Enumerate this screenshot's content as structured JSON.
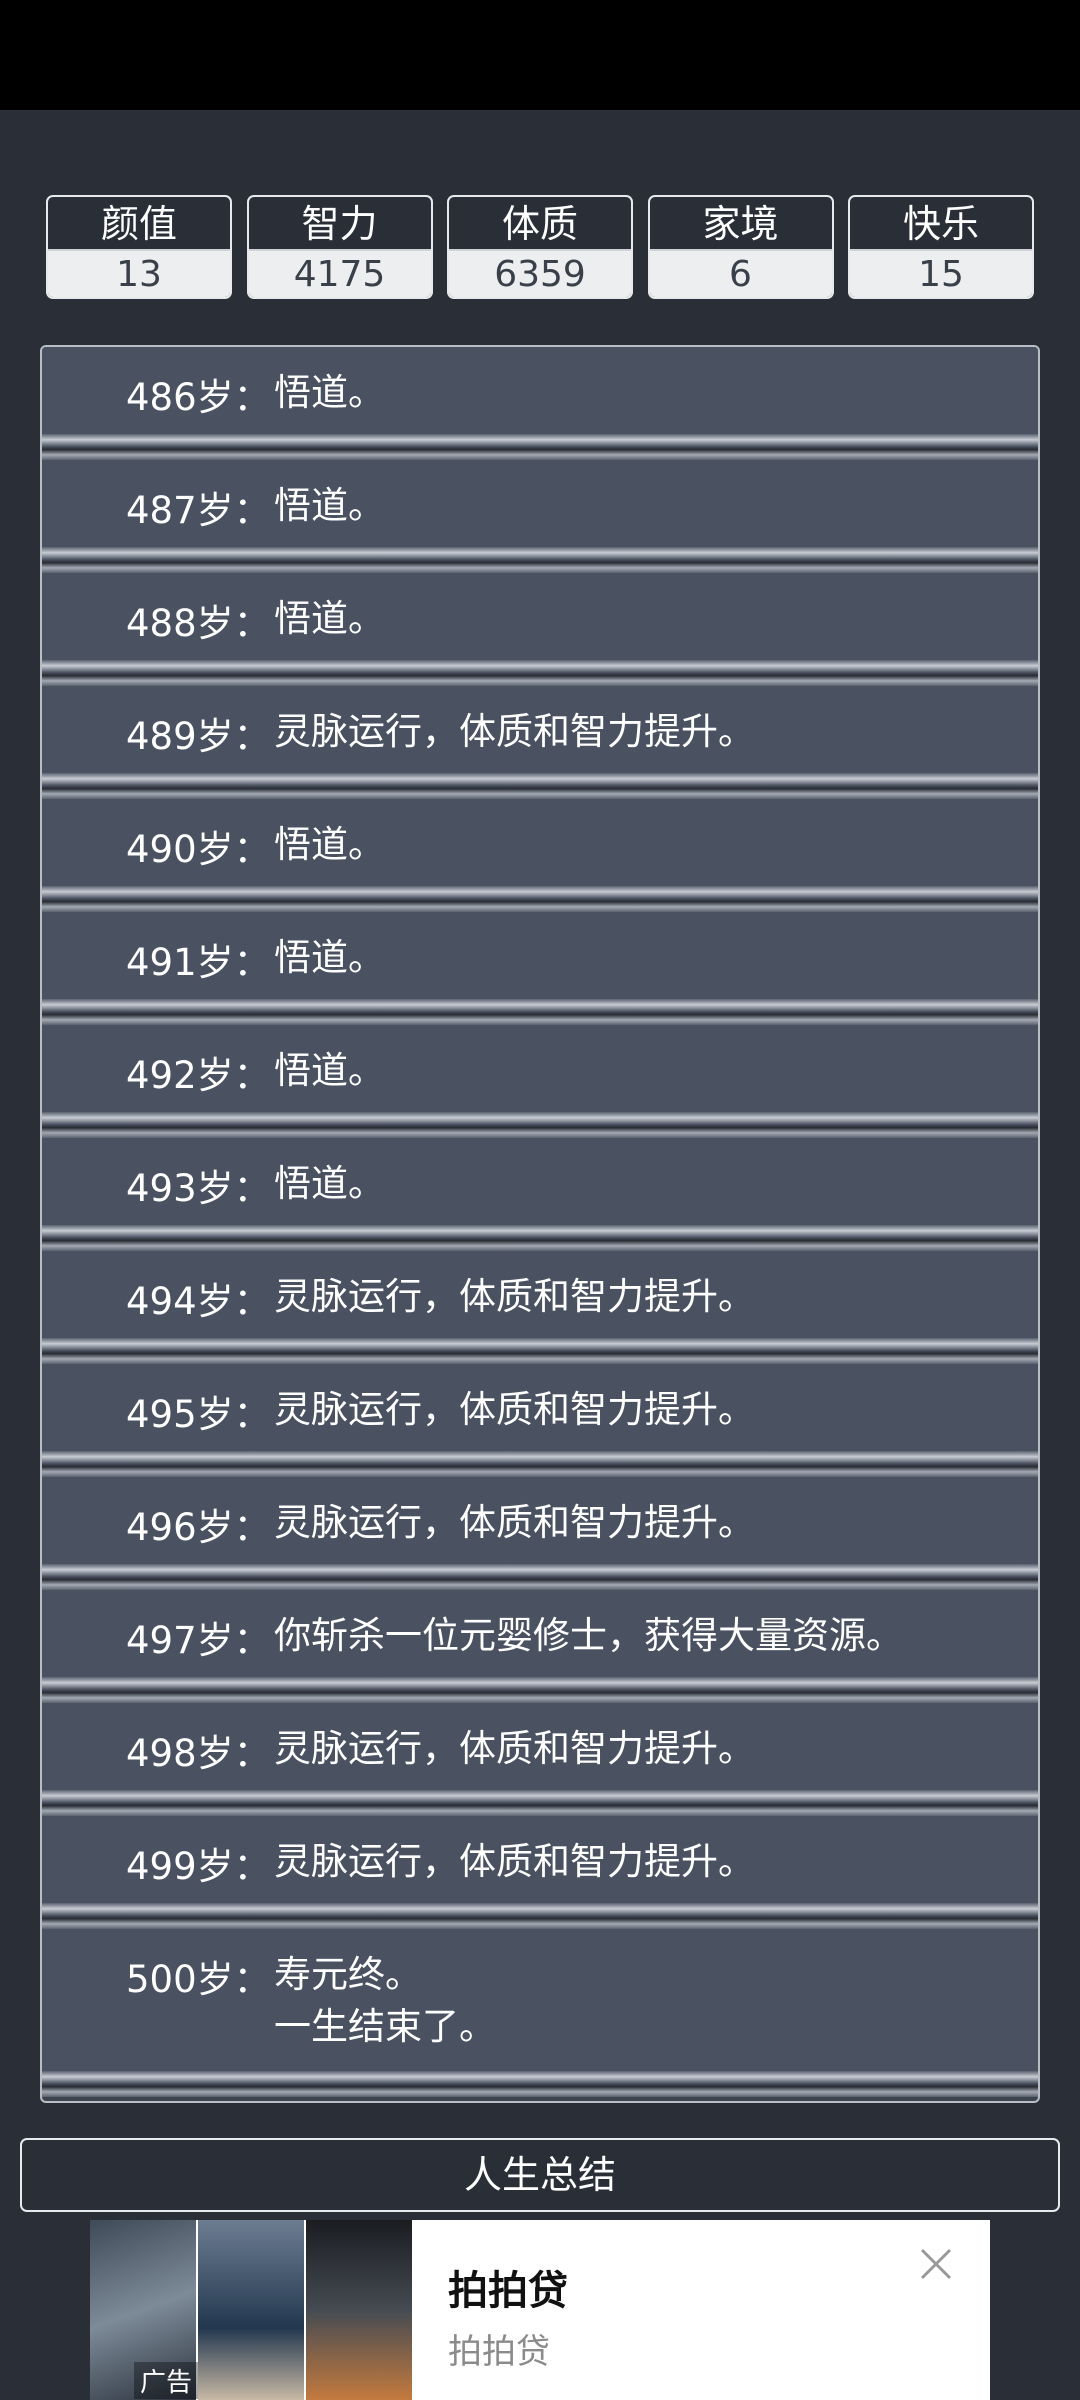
{
  "stats": [
    {
      "label": "颜值",
      "value": "13"
    },
    {
      "label": "智力",
      "value": "4175"
    },
    {
      "label": "体质",
      "value": "6359"
    },
    {
      "label": "家境",
      "value": "6"
    },
    {
      "label": "快乐",
      "value": "15"
    }
  ],
  "entries": [
    {
      "age": "486岁：",
      "text": "悟道。"
    },
    {
      "age": "487岁：",
      "text": "悟道。"
    },
    {
      "age": "488岁：",
      "text": "悟道。"
    },
    {
      "age": "489岁：",
      "text": "灵脉运行，体质和智力提升。"
    },
    {
      "age": "490岁：",
      "text": "悟道。"
    },
    {
      "age": "491岁：",
      "text": "悟道。"
    },
    {
      "age": "492岁：",
      "text": "悟道。"
    },
    {
      "age": "493岁：",
      "text": "悟道。"
    },
    {
      "age": "494岁：",
      "text": "灵脉运行，体质和智力提升。"
    },
    {
      "age": "495岁：",
      "text": "灵脉运行，体质和智力提升。"
    },
    {
      "age": "496岁：",
      "text": "灵脉运行，体质和智力提升。"
    },
    {
      "age": "497岁：",
      "text": "你斩杀一位元婴修士，获得大量资源。"
    },
    {
      "age": "498岁：",
      "text": "灵脉运行，体质和智力提升。"
    },
    {
      "age": "499岁：",
      "text": "灵脉运行，体质和智力提升。"
    },
    {
      "age": "500岁：",
      "text": "寿元终。",
      "text2": "一生结束了。"
    }
  ],
  "summary_label": "人生总结",
  "ad": {
    "badge": "广告",
    "title": "拍拍贷",
    "subtitle": "拍拍贷",
    "close_icon": "close-icon"
  }
}
